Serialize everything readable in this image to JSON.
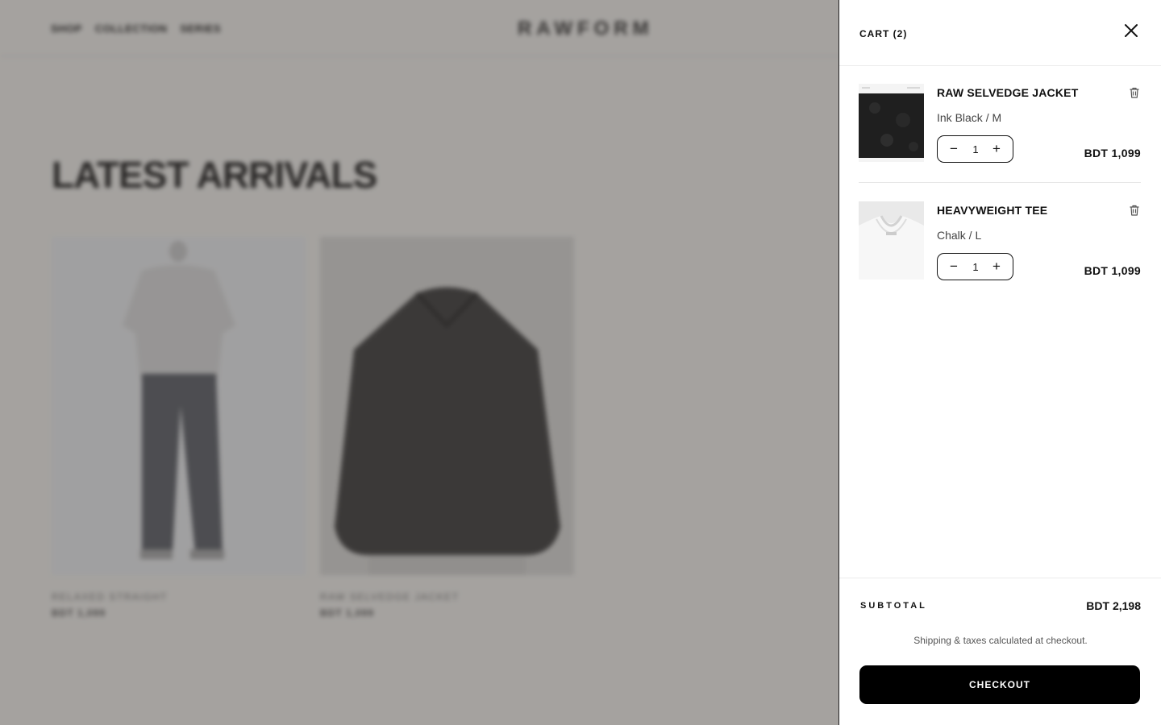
{
  "background": {
    "nav": [
      "SHOP",
      "COLLECTION",
      "SERIES"
    ],
    "brand": "RAWFORM",
    "page_title": "LATEST ARRIVALS",
    "products": [
      {
        "name": "RELAXED STRAIGHT",
        "price": "BDT 1,099"
      },
      {
        "name": "RAW SELVEDGE JACKET",
        "price": "BDT 1,099"
      }
    ]
  },
  "cart": {
    "title": "CART (2)",
    "close_icon": "close-icon",
    "items": [
      {
        "name": "RAW SELVEDGE JACKET",
        "variant": "Ink Black / M",
        "quantity": "1",
        "price": "BDT 1,099",
        "thumb": "jacket"
      },
      {
        "name": "HEAVYWEIGHT TEE",
        "variant": "Chalk / L",
        "quantity": "1",
        "price": "BDT 1,099",
        "thumb": "tee"
      }
    ],
    "qty_minus": "−",
    "qty_plus": "+",
    "subtotal_label": "SUBTOTAL",
    "subtotal_value": "BDT 2,198",
    "shipping_note": "Shipping & taxes calculated at checkout.",
    "checkout_label": "CHECKOUT"
  },
  "colors": {
    "overlay": "#6b6765",
    "accent": "#000000",
    "drawer_bg": "#ffffff"
  }
}
